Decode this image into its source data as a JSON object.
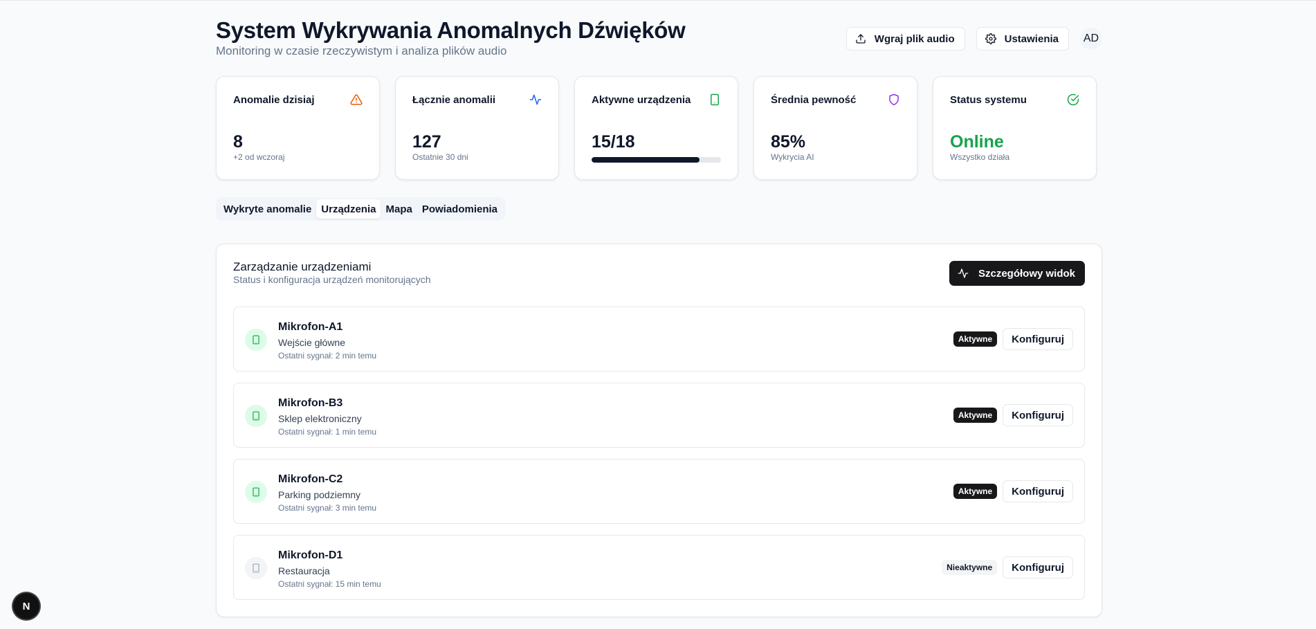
{
  "header": {
    "title": "System Wykrywania Anomalnych Dźwięków",
    "subtitle": "Monitoring w czasie rzeczywistym i analiza plików audio",
    "upload_label": "Wgraj plik audio",
    "settings_label": "Ustawienia",
    "avatar_initials": "AD"
  },
  "stats": {
    "anomalies_today": {
      "label": "Anomalie dzisiaj",
      "value": "8",
      "sub": "+2 od wczoraj",
      "icon": "alert-triangle-icon",
      "color": "#ea580c"
    },
    "total_anomalies": {
      "label": "Łącznie anomalii",
      "value": "127",
      "sub": "Ostatnie 30 dni",
      "icon": "activity-icon",
      "color": "#2563eb"
    },
    "active_devices": {
      "label": "Aktywne urządzenia",
      "value": "15/18",
      "progress": 0.833,
      "icon": "smartphone-icon",
      "color": "#16a34a"
    },
    "avg_confidence": {
      "label": "Średnia pewność",
      "value": "85%",
      "sub": "Wykrycia AI",
      "icon": "shield-icon",
      "color": "#9333ea"
    },
    "system_status": {
      "label": "Status systemu",
      "value": "Online",
      "sub": "Wszystko działa",
      "icon": "check-circle-icon",
      "color": "#16a34a"
    }
  },
  "tabs": [
    {
      "label": "Wykryte anomalie",
      "active": false
    },
    {
      "label": "Urządzenia",
      "active": true
    },
    {
      "label": "Mapa",
      "active": false
    },
    {
      "label": "Powiadomienia",
      "active": false
    }
  ],
  "panel": {
    "title": "Zarządzanie urządzeniami",
    "description": "Status i konfiguracja urządzeń monitorujących",
    "detail_button": "Szczegółowy widok"
  },
  "devices": [
    {
      "name": "Mikrofon-A1",
      "location": "Wejście główne",
      "signal": "Ostatni sygnał: 2 min temu",
      "status": "Aktywne",
      "active": true,
      "action": "Konfiguruj"
    },
    {
      "name": "Mikrofon-B3",
      "location": "Sklep elektroniczny",
      "signal": "Ostatni sygnał: 1 min temu",
      "status": "Aktywne",
      "active": true,
      "action": "Konfiguruj"
    },
    {
      "name": "Mikrofon-C2",
      "location": "Parking podziemny",
      "signal": "Ostatni sygnał: 3 min temu",
      "status": "Aktywne",
      "active": true,
      "action": "Konfiguruj"
    },
    {
      "name": "Mikrofon-D1",
      "location": "Restauracja",
      "signal": "Ostatni sygnał: 15 min temu",
      "status": "Nieaktywne",
      "active": false,
      "action": "Konfiguruj"
    }
  ],
  "dev_badge": "N"
}
